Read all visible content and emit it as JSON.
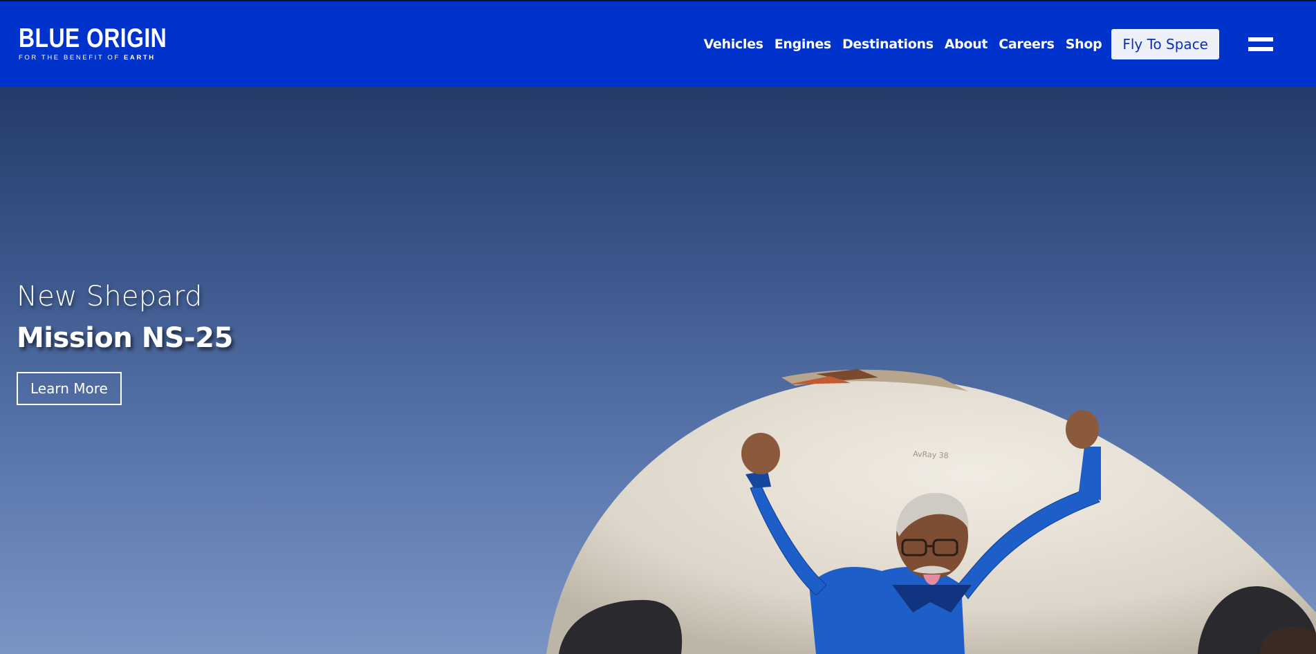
{
  "brand": {
    "name": "BLUE ORIGIN",
    "tagline_prefix": "FOR THE BENEFIT OF ",
    "tagline_emphasis": "EARTH"
  },
  "nav": {
    "items": [
      {
        "label": "Vehicles"
      },
      {
        "label": "Engines"
      },
      {
        "label": "Destinations"
      },
      {
        "label": "About"
      },
      {
        "label": "Careers"
      },
      {
        "label": "Shop"
      }
    ],
    "cta_label": "Fly To Space",
    "menu_icon": "hamburger-menu-icon"
  },
  "hero": {
    "subtitle": "New Shepard",
    "title": "Mission NS-25",
    "button_label": "Learn More",
    "capsule_marking": "AvRay 38"
  },
  "colors": {
    "header_bg": "#0033cc",
    "cta_bg": "#eef0f8",
    "cta_text": "#0a2fb8",
    "sky_top": "#243b68",
    "sky_bottom": "#7a94c4",
    "flight_suit": "#1e5ec8"
  }
}
